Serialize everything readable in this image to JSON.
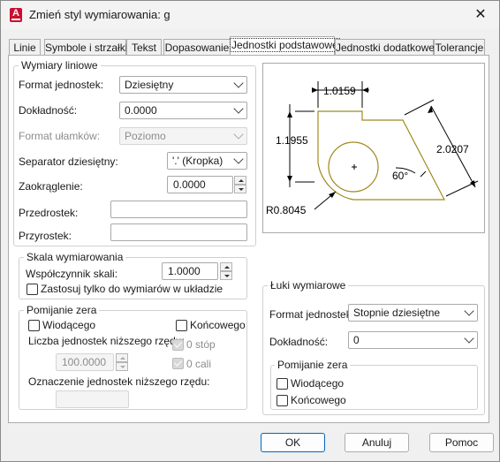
{
  "window": {
    "title": "Zmień styl wymiarowania: g",
    "close_glyph": "✕",
    "app_icon_letter": "A"
  },
  "tabs": [
    {
      "label": "Linie"
    },
    {
      "label": "Symbole i strzałki"
    },
    {
      "label": "Tekst"
    },
    {
      "label": "Dopasowanie"
    },
    {
      "label": "Jednostki podstawowe",
      "active": true
    },
    {
      "label": "Jednostki dodatkowe"
    },
    {
      "label": "Tolerancje"
    }
  ],
  "linear": {
    "legend": "Wymiary liniowe",
    "unit_format_label": "Format jednostek:",
    "unit_format_value": "Dziesiętny",
    "precision_label": "Dokładność:",
    "precision_value": "0.0000",
    "fraction_format_label": "Format ułamków:",
    "fraction_format_value": "Poziomo",
    "decimal_sep_label": "Separator dziesiętny:",
    "decimal_sep_value": "'.' (Kropka)",
    "round_label": "Zaokrąglenie:",
    "round_value": "0.0000",
    "prefix_label": "Przedrostek:",
    "prefix_value": "",
    "suffix_label": "Przyrostek:",
    "suffix_value": ""
  },
  "scale": {
    "legend": "Skala wymiarowania",
    "factor_label": "Współczynnik skali:",
    "factor_value": "1.0000",
    "layout_only_label": "Zastosuj tylko do wymiarów w układzie"
  },
  "zero_linear": {
    "legend": "Pomijanie zera",
    "leading_label": "Wiodącego",
    "trailing_label": "Końcowego",
    "sub_units_factor_label": "Liczba jednostek niższego rzędu:",
    "sub_units_factor_value": "100.0000",
    "feet_label": "0 stóp",
    "inches_label": "0 cali",
    "sub_unit_suffix_label": "Oznaczenie jednostek niższego rzędu:"
  },
  "preview": {
    "dim_top": "1.0159",
    "dim_left": "1.1955",
    "dim_diag": "2.0207",
    "angle": "60°",
    "radius": "R0.8045",
    "colors": {
      "shape": "#a08a1e",
      "dim": "#000000"
    }
  },
  "angular": {
    "legend": "Łuki wymiarowe",
    "unit_format_label": "Format jednostek:",
    "unit_format_value": "Stopnie dziesiętne",
    "precision_label": "Dokładność:",
    "precision_value": "0",
    "zero_legend": "Pomijanie zera",
    "leading_label": "Wiodącego",
    "trailing_label": "Końcowego"
  },
  "buttons": {
    "ok": "OK",
    "cancel": "Anuluj",
    "help": "Pomoc"
  }
}
